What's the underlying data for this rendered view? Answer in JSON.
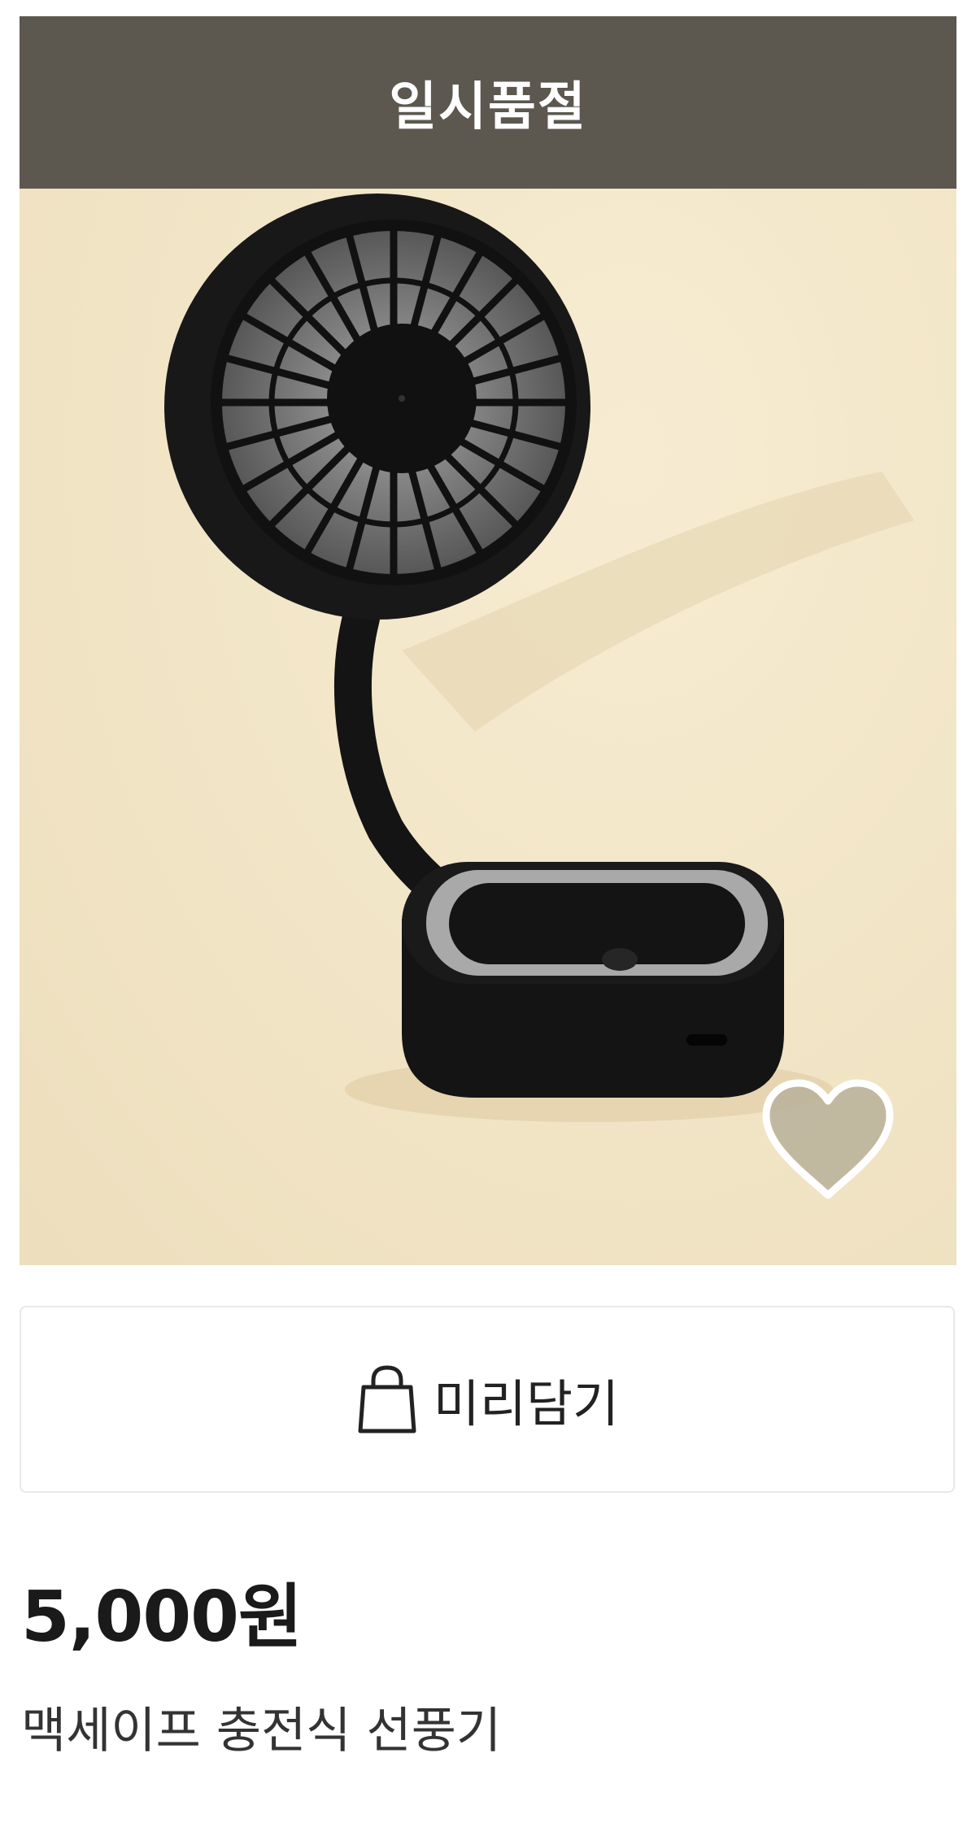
{
  "product": {
    "status_badge": "일시품절",
    "cart_label": "미리담기",
    "price": "5,000원",
    "name": "맥세이프 충전식 선풍기"
  },
  "icons": {
    "cart": "shopping-bag-icon",
    "wishlist": "heart-icon"
  },
  "colors": {
    "badge_bg": "#5c5850",
    "image_bg": "#f2e6c9",
    "text": "#1a1a1a"
  }
}
